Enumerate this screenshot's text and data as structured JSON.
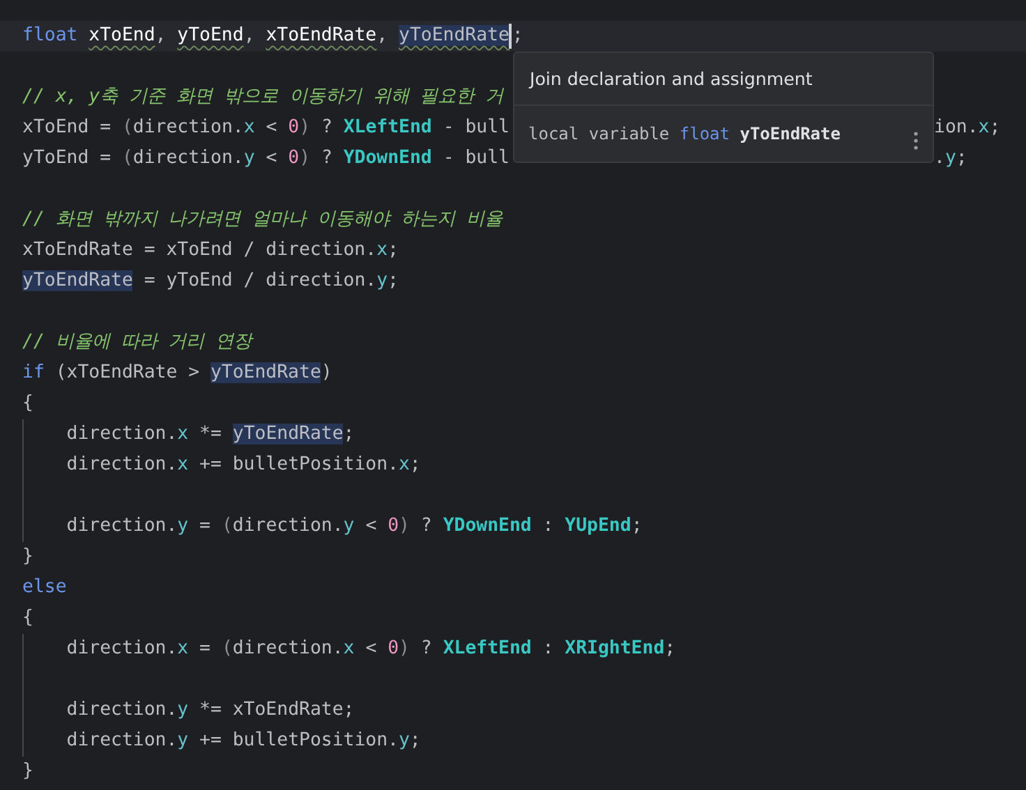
{
  "editor": {
    "lines": [
      {
        "current": true,
        "caret": true,
        "guide": false,
        "tokens": [
          {
            "text": "float ",
            "kind": "kw"
          },
          {
            "text": "xToEnd",
            "kind": "squiggle"
          },
          {
            "text": ", ",
            "kind": "id"
          },
          {
            "text": "yToEnd",
            "kind": "squiggle"
          },
          {
            "text": ", ",
            "kind": "id"
          },
          {
            "text": "xToEndRate",
            "kind": "squiggle"
          },
          {
            "text": ", ",
            "kind": "id"
          },
          {
            "text": "yToEndRate",
            "kind": "usage_squiggle"
          }
        ],
        "after_caret": [
          {
            "text": ";",
            "kind": "id"
          }
        ]
      },
      {
        "current": false,
        "caret": false,
        "guide": false
      },
      {
        "current": false,
        "caret": false,
        "guide": false,
        "tokens": [
          {
            "text": "// x, y축 기준 화면 밖으로 이동하기 위해 필요한 거",
            "kind": "comment"
          }
        ]
      },
      {
        "current": false,
        "caret": false,
        "guide": false,
        "tokens": [
          {
            "text": "xToEnd = ",
            "kind": "id"
          },
          {
            "text": "(",
            "kind": "dim"
          },
          {
            "text": "direction.",
            "kind": "id"
          },
          {
            "text": "x",
            "kind": "member"
          },
          {
            "text": " < ",
            "kind": "id"
          },
          {
            "text": "0",
            "kind": "num"
          },
          {
            "text": ")",
            "kind": "dim"
          },
          {
            "text": " ? ",
            "kind": "id"
          },
          {
            "text": "XLeftEnd",
            "kind": "const"
          },
          {
            "text": " - bull",
            "kind": "id"
          }
        ],
        "tail": [
          {
            "text": "ion.",
            "kind": "id"
          },
          {
            "text": "x",
            "kind": "member"
          },
          {
            "text": ";",
            "kind": "id"
          }
        ]
      },
      {
        "current": false,
        "caret": false,
        "guide": false,
        "tokens": [
          {
            "text": "yToEnd = ",
            "kind": "id"
          },
          {
            "text": "(",
            "kind": "dim"
          },
          {
            "text": "direction.",
            "kind": "id"
          },
          {
            "text": "y",
            "kind": "member"
          },
          {
            "text": " < ",
            "kind": "id"
          },
          {
            "text": "0",
            "kind": "num"
          },
          {
            "text": ")",
            "kind": "dim"
          },
          {
            "text": " ? ",
            "kind": "id"
          },
          {
            "text": "YDownEnd",
            "kind": "const"
          },
          {
            "text": " - bull",
            "kind": "id"
          }
        ],
        "tail": [
          {
            "text": ".",
            "kind": "id"
          },
          {
            "text": "y",
            "kind": "member"
          },
          {
            "text": ";",
            "kind": "id"
          }
        ]
      },
      {
        "current": false,
        "caret": false,
        "guide": false
      },
      {
        "current": false,
        "caret": false,
        "guide": false,
        "tokens": [
          {
            "text": "// 화면 밖까지 나가려면 얼마나 이동해야 하는지 비율",
            "kind": "comment"
          }
        ]
      },
      {
        "current": false,
        "caret": false,
        "guide": false,
        "tokens": [
          {
            "text": "xToEndRate = xToEnd / direction.",
            "kind": "id"
          },
          {
            "text": "x",
            "kind": "member"
          },
          {
            "text": ";",
            "kind": "id"
          }
        ]
      },
      {
        "current": false,
        "caret": false,
        "guide": false,
        "tokens": [
          {
            "text": "yToEndRate",
            "kind": "usage"
          },
          {
            "text": " = yToEnd / direction.",
            "kind": "id"
          },
          {
            "text": "y",
            "kind": "member"
          },
          {
            "text": ";",
            "kind": "id"
          }
        ]
      },
      {
        "current": false,
        "caret": false,
        "guide": false
      },
      {
        "current": false,
        "caret": false,
        "guide": false,
        "tokens": [
          {
            "text": "// 비율에 따라 거리 연장",
            "kind": "comment"
          }
        ]
      },
      {
        "current": false,
        "caret": false,
        "guide": false,
        "tokens": [
          {
            "text": "if",
            "kind": "kw"
          },
          {
            "text": " (xToEndRate > ",
            "kind": "id"
          },
          {
            "text": "yToEndRate",
            "kind": "usage"
          },
          {
            "text": ")",
            "kind": "id"
          }
        ]
      },
      {
        "current": false,
        "caret": false,
        "guide": false,
        "tokens": [
          {
            "text": "{",
            "kind": "id"
          }
        ]
      },
      {
        "current": false,
        "caret": false,
        "guide": true,
        "tokens": [
          {
            "text": "    direction.",
            "kind": "id"
          },
          {
            "text": "x",
            "kind": "member"
          },
          {
            "text": " *= ",
            "kind": "id"
          },
          {
            "text": "yToEndRate",
            "kind": "usage"
          },
          {
            "text": ";",
            "kind": "id"
          }
        ]
      },
      {
        "current": false,
        "caret": false,
        "guide": true,
        "tokens": [
          {
            "text": "    direction.",
            "kind": "id"
          },
          {
            "text": "x",
            "kind": "member"
          },
          {
            "text": " += bulletPosition.",
            "kind": "id"
          },
          {
            "text": "x",
            "kind": "member"
          },
          {
            "text": ";",
            "kind": "id"
          }
        ]
      },
      {
        "current": false,
        "caret": false,
        "guide": true
      },
      {
        "current": false,
        "caret": false,
        "guide": true,
        "tokens": [
          {
            "text": "    direction.",
            "kind": "id"
          },
          {
            "text": "y",
            "kind": "member"
          },
          {
            "text": " = ",
            "kind": "id"
          },
          {
            "text": "(",
            "kind": "dim"
          },
          {
            "text": "direction.",
            "kind": "id"
          },
          {
            "text": "y",
            "kind": "member"
          },
          {
            "text": " < ",
            "kind": "id"
          },
          {
            "text": "0",
            "kind": "num"
          },
          {
            "text": ")",
            "kind": "dim"
          },
          {
            "text": " ? ",
            "kind": "id"
          },
          {
            "text": "YDownEnd",
            "kind": "const"
          },
          {
            "text": " : ",
            "kind": "id"
          },
          {
            "text": "YUpEnd",
            "kind": "const"
          },
          {
            "text": ";",
            "kind": "id"
          }
        ]
      },
      {
        "current": false,
        "caret": false,
        "guide": false,
        "tokens": [
          {
            "text": "}",
            "kind": "id"
          }
        ]
      },
      {
        "current": false,
        "caret": false,
        "guide": false,
        "tokens": [
          {
            "text": "else",
            "kind": "kw"
          }
        ]
      },
      {
        "current": false,
        "caret": false,
        "guide": false,
        "tokens": [
          {
            "text": "{",
            "kind": "id"
          }
        ]
      },
      {
        "current": false,
        "caret": false,
        "guide": true,
        "tokens": [
          {
            "text": "    direction.",
            "kind": "id"
          },
          {
            "text": "x",
            "kind": "member"
          },
          {
            "text": " = ",
            "kind": "id"
          },
          {
            "text": "(",
            "kind": "dim"
          },
          {
            "text": "direction.",
            "kind": "id"
          },
          {
            "text": "x",
            "kind": "member"
          },
          {
            "text": " < ",
            "kind": "id"
          },
          {
            "text": "0",
            "kind": "num"
          },
          {
            "text": ")",
            "kind": "dim"
          },
          {
            "text": " ? ",
            "kind": "id"
          },
          {
            "text": "XLeftEnd",
            "kind": "const"
          },
          {
            "text": " : ",
            "kind": "id"
          },
          {
            "text": "XRIghtEnd",
            "kind": "const"
          },
          {
            "text": ";",
            "kind": "id"
          }
        ]
      },
      {
        "current": false,
        "caret": false,
        "guide": true
      },
      {
        "current": false,
        "caret": false,
        "guide": true,
        "tokens": [
          {
            "text": "    direction.",
            "kind": "id"
          },
          {
            "text": "y",
            "kind": "member"
          },
          {
            "text": " *= xToEndRate;",
            "kind": "id"
          }
        ]
      },
      {
        "current": false,
        "caret": false,
        "guide": true,
        "tokens": [
          {
            "text": "    direction.",
            "kind": "id"
          },
          {
            "text": "y",
            "kind": "member"
          },
          {
            "text": " += bulletPosition.",
            "kind": "id"
          },
          {
            "text": "y",
            "kind": "member"
          },
          {
            "text": ";",
            "kind": "id"
          }
        ]
      },
      {
        "current": false,
        "caret": false,
        "guide": false,
        "tokens": [
          {
            "text": "}",
            "kind": "id"
          }
        ]
      }
    ]
  },
  "popup": {
    "action": "Join declaration and assignment",
    "info": [
      {
        "text": "local variable ",
        "kind": "id"
      },
      {
        "text": "float ",
        "kind": "kw"
      },
      {
        "text": "yToEndRate",
        "kind": "bold"
      }
    ]
  }
}
